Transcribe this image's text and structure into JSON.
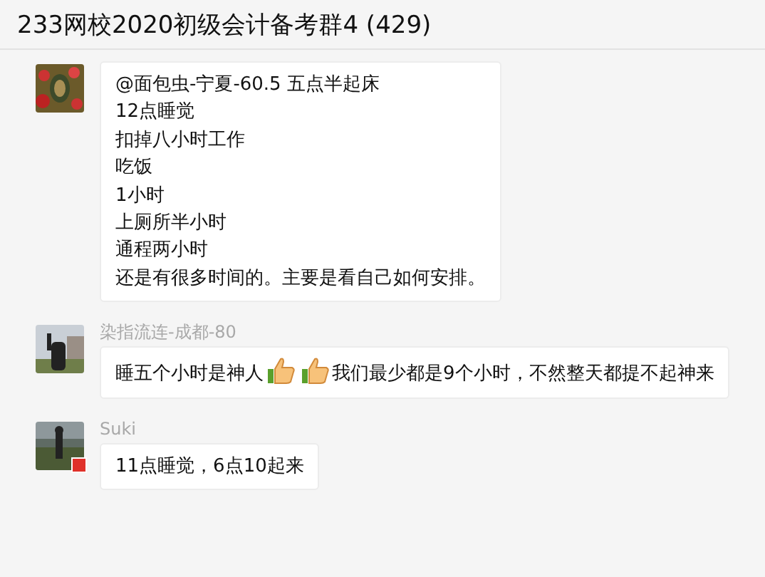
{
  "window": {
    "title": "233网校2020初级会计备考群4 (429)"
  },
  "messages": [
    {
      "flag_badge": false,
      "lines": [
        {
          "parts": [
            {
              "kind": "text",
              "text": "@面包虫-宁夏-60.5 五点半起床"
            }
          ]
        },
        {
          "parts": [
            {
              "kind": "text",
              "text": "12点睡觉"
            }
          ]
        },
        {
          "parts": [
            {
              "kind": "text",
              "text": "扣掉八小时工作"
            }
          ]
        },
        {
          "parts": [
            {
              "kind": "text",
              "text": "吃饭"
            }
          ]
        },
        {
          "parts": [
            {
              "kind": "text",
              "text": "1小时"
            }
          ]
        },
        {
          "parts": [
            {
              "kind": "text",
              "text": "上厕所半小时"
            }
          ]
        },
        {
          "parts": [
            {
              "kind": "text",
              "text": "通程两小时"
            }
          ]
        },
        {
          "parts": [
            {
              "kind": "text",
              "text": "还是有很多时间的。主要是看自己如何安排。"
            }
          ]
        }
      ]
    },
    {
      "sender": "染指流连-成都-80",
      "flag_badge": false,
      "lines": [
        {
          "parts": [
            {
              "kind": "text",
              "text": "睡五个小时是神人"
            },
            {
              "kind": "thumbs_up"
            },
            {
              "kind": "thumbs_up"
            },
            {
              "kind": "text",
              "text": "我们最少都是9个小时，不然整天都提不起神来"
            }
          ]
        }
      ]
    },
    {
      "sender": "Suki",
      "flag_badge": true,
      "lines": [
        {
          "parts": [
            {
              "kind": "text",
              "text": "11点睡觉，6点10起来"
            }
          ]
        }
      ]
    }
  ]
}
